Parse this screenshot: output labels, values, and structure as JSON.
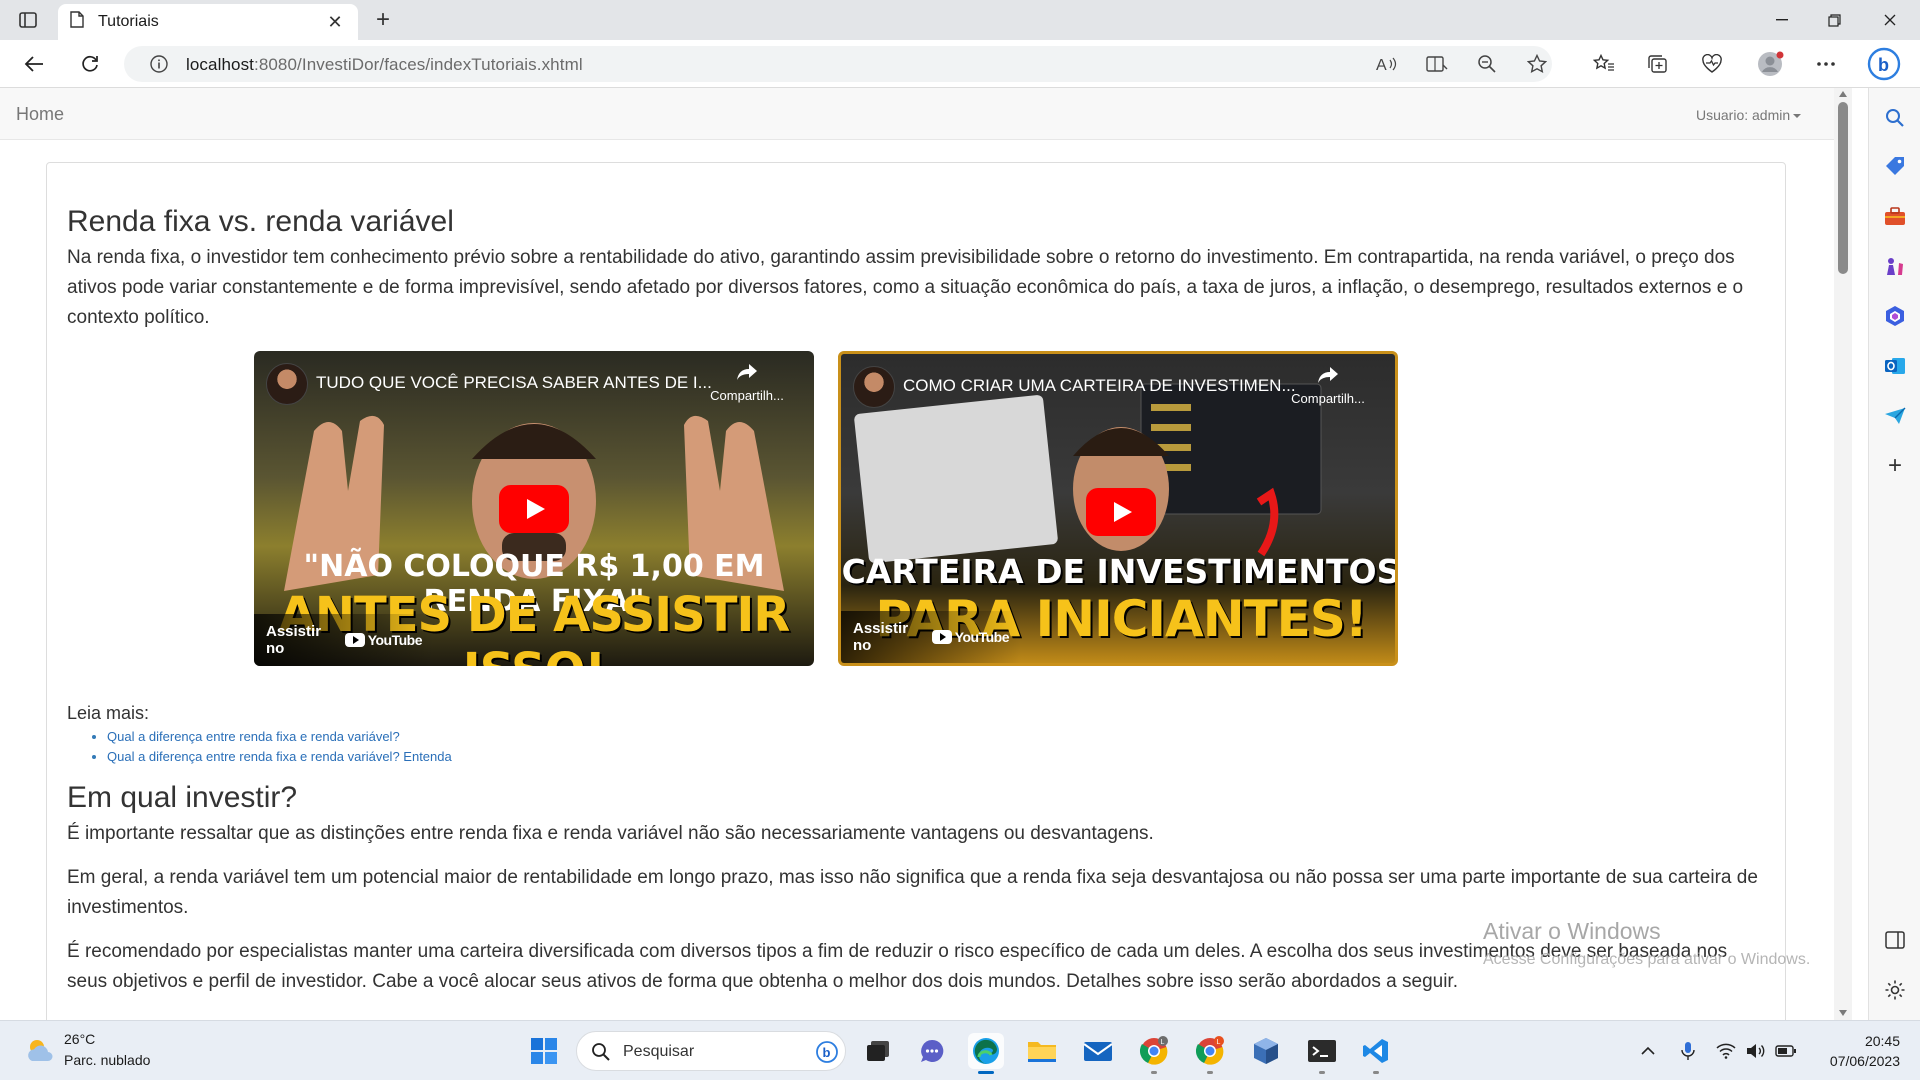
{
  "browser": {
    "tab_title": "Tutoriais",
    "url_host": "localhost",
    "url_rest": ":8080/InvestiDor/faces/indexTutoriais.xhtml"
  },
  "navbar": {
    "home": "Home",
    "user": "Usuario: admin"
  },
  "section1": {
    "title": "Renda fixa vs. renda variável",
    "paragraph": "Na renda fixa, o investidor tem conhecimento prévio sobre a rentabilidade do ativo, garantindo assim previsibilidade sobre o retorno do investimento. Em contrapartida, na renda variável, o preço dos ativos pode variar constantemente e de forma imprevisível, sendo afetado por diversos fatores, como a situação econômica do país, a taxa de juros, a inflação, o desemprego, resultados externos e o contexto político."
  },
  "videos": [
    {
      "title": "TUDO QUE VOCÊ PRECISA SABER ANTES DE I...",
      "share": "Compartilh...",
      "caption_top": "\"NÃO COLOQUE R$ 1,00 EM RENDA FIXA\"",
      "caption_bottom": "ANTES DE ASSISTIR ISSO!",
      "watch": "Assistir no",
      "yt": "YouTube"
    },
    {
      "title": "COMO CRIAR UMA CARTEIRA DE INVESTIMEN...",
      "share": "Compartilh...",
      "caption_top": "CARTEIRA DE INVESTIMENTOS",
      "caption_bottom": "PARA INICIANTES!",
      "watch": "Assistir no",
      "yt": "YouTube"
    }
  ],
  "leia_mais": {
    "label": "Leia mais:",
    "links": [
      "Qual a diferença entre renda fixa e renda variável?",
      "Qual a diferença entre renda fixa e renda variável? Entenda"
    ]
  },
  "section2": {
    "title": "Em qual investir?",
    "p1": "É importante ressaltar que as distinções entre renda fixa e renda variável não são necessariamente vantagens ou desvantagens.",
    "p2": "Em geral, a renda variável tem um potencial maior de rentabilidade em longo prazo, mas isso não significa que a renda fixa seja desvantajosa ou não possa ser uma parte importante de sua carteira de investimentos.",
    "p3": "É recomendado por especialistas manter uma carteira diversificada com diversos tipos a fim de reduzir o risco específico de cada um deles. A escolha dos seus investimentos deve ser baseada nos seus objetivos e perfil de investidor. Cabe a você alocar seus ativos de forma que obtenha o melhor dos dois mundos. Detalhes sobre isso serão abordados a seguir."
  },
  "watermark": {
    "line1": "Ativar o Windows",
    "line2": "Acesse Configurações para ativar o Windows."
  },
  "taskbar": {
    "temperature": "26°C",
    "weather": "Parc. nublado",
    "search": "Pesquisar",
    "time": "20:45",
    "date": "07/06/2023"
  },
  "colors": {
    "link": "#2a6fb8",
    "edge_accent": "#0067c0",
    "youtube_red": "#ff0000",
    "caption_yellow": "#f6c21a"
  }
}
